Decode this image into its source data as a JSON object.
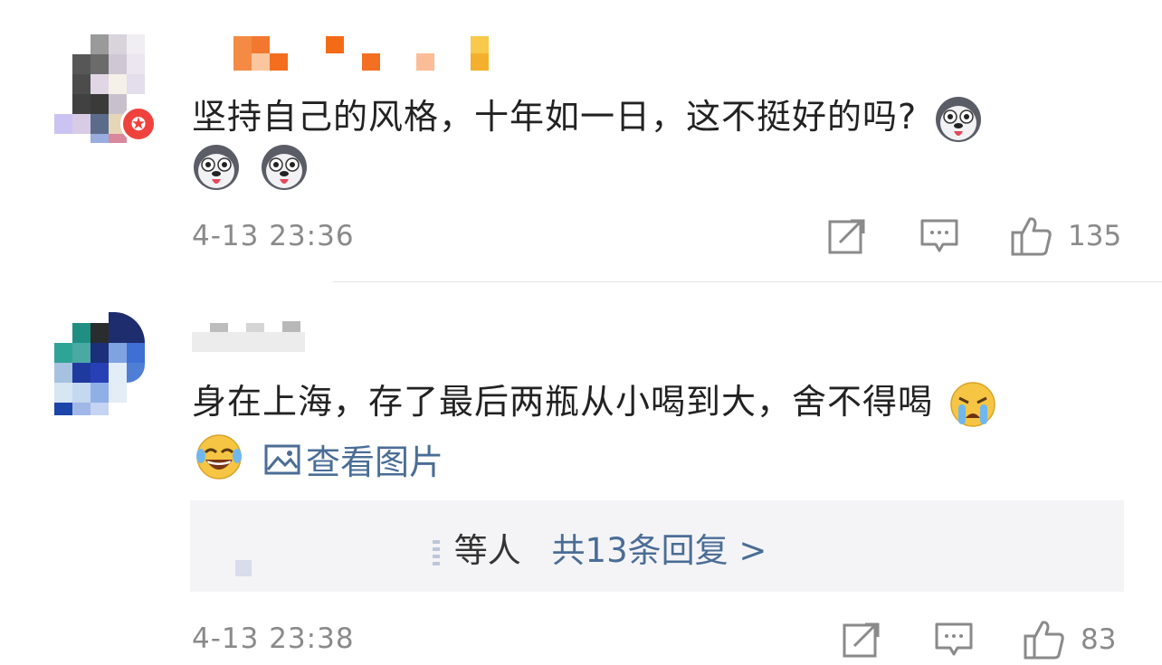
{
  "comments": [
    {
      "text_line1": "坚持自己的风格，十年如一日，这不挺好的吗?",
      "emojis_line1": [
        "husky-emoji"
      ],
      "emojis_line2": [
        "husky-emoji",
        "husky-emoji"
      ],
      "time": "4-13 23:36",
      "likes": "135",
      "vip_badge_icon": "vip-badge-icon"
    },
    {
      "text_line1": "身在上海，存了最后两瓶从小喝到大，舍不得喝",
      "emojis_line1": [
        "crying-emoji"
      ],
      "emojis_line2": [
        "laughing-crying-emoji"
      ],
      "view_image_label": "查看图片",
      "replies_suffix": "等人",
      "replies_link": "共13条回复 >",
      "time": "4-13 23:38",
      "likes": "83"
    }
  ],
  "colors": {
    "text": "#222222",
    "meta": "#8a8a8a",
    "link": "#4a6d96",
    "reply_bg": "#f4f4f6",
    "badge": "#f0423c"
  },
  "icons": {
    "repost": "repost-icon",
    "reply": "comment-icon",
    "like": "thumbs-up-icon",
    "image": "image-icon"
  }
}
